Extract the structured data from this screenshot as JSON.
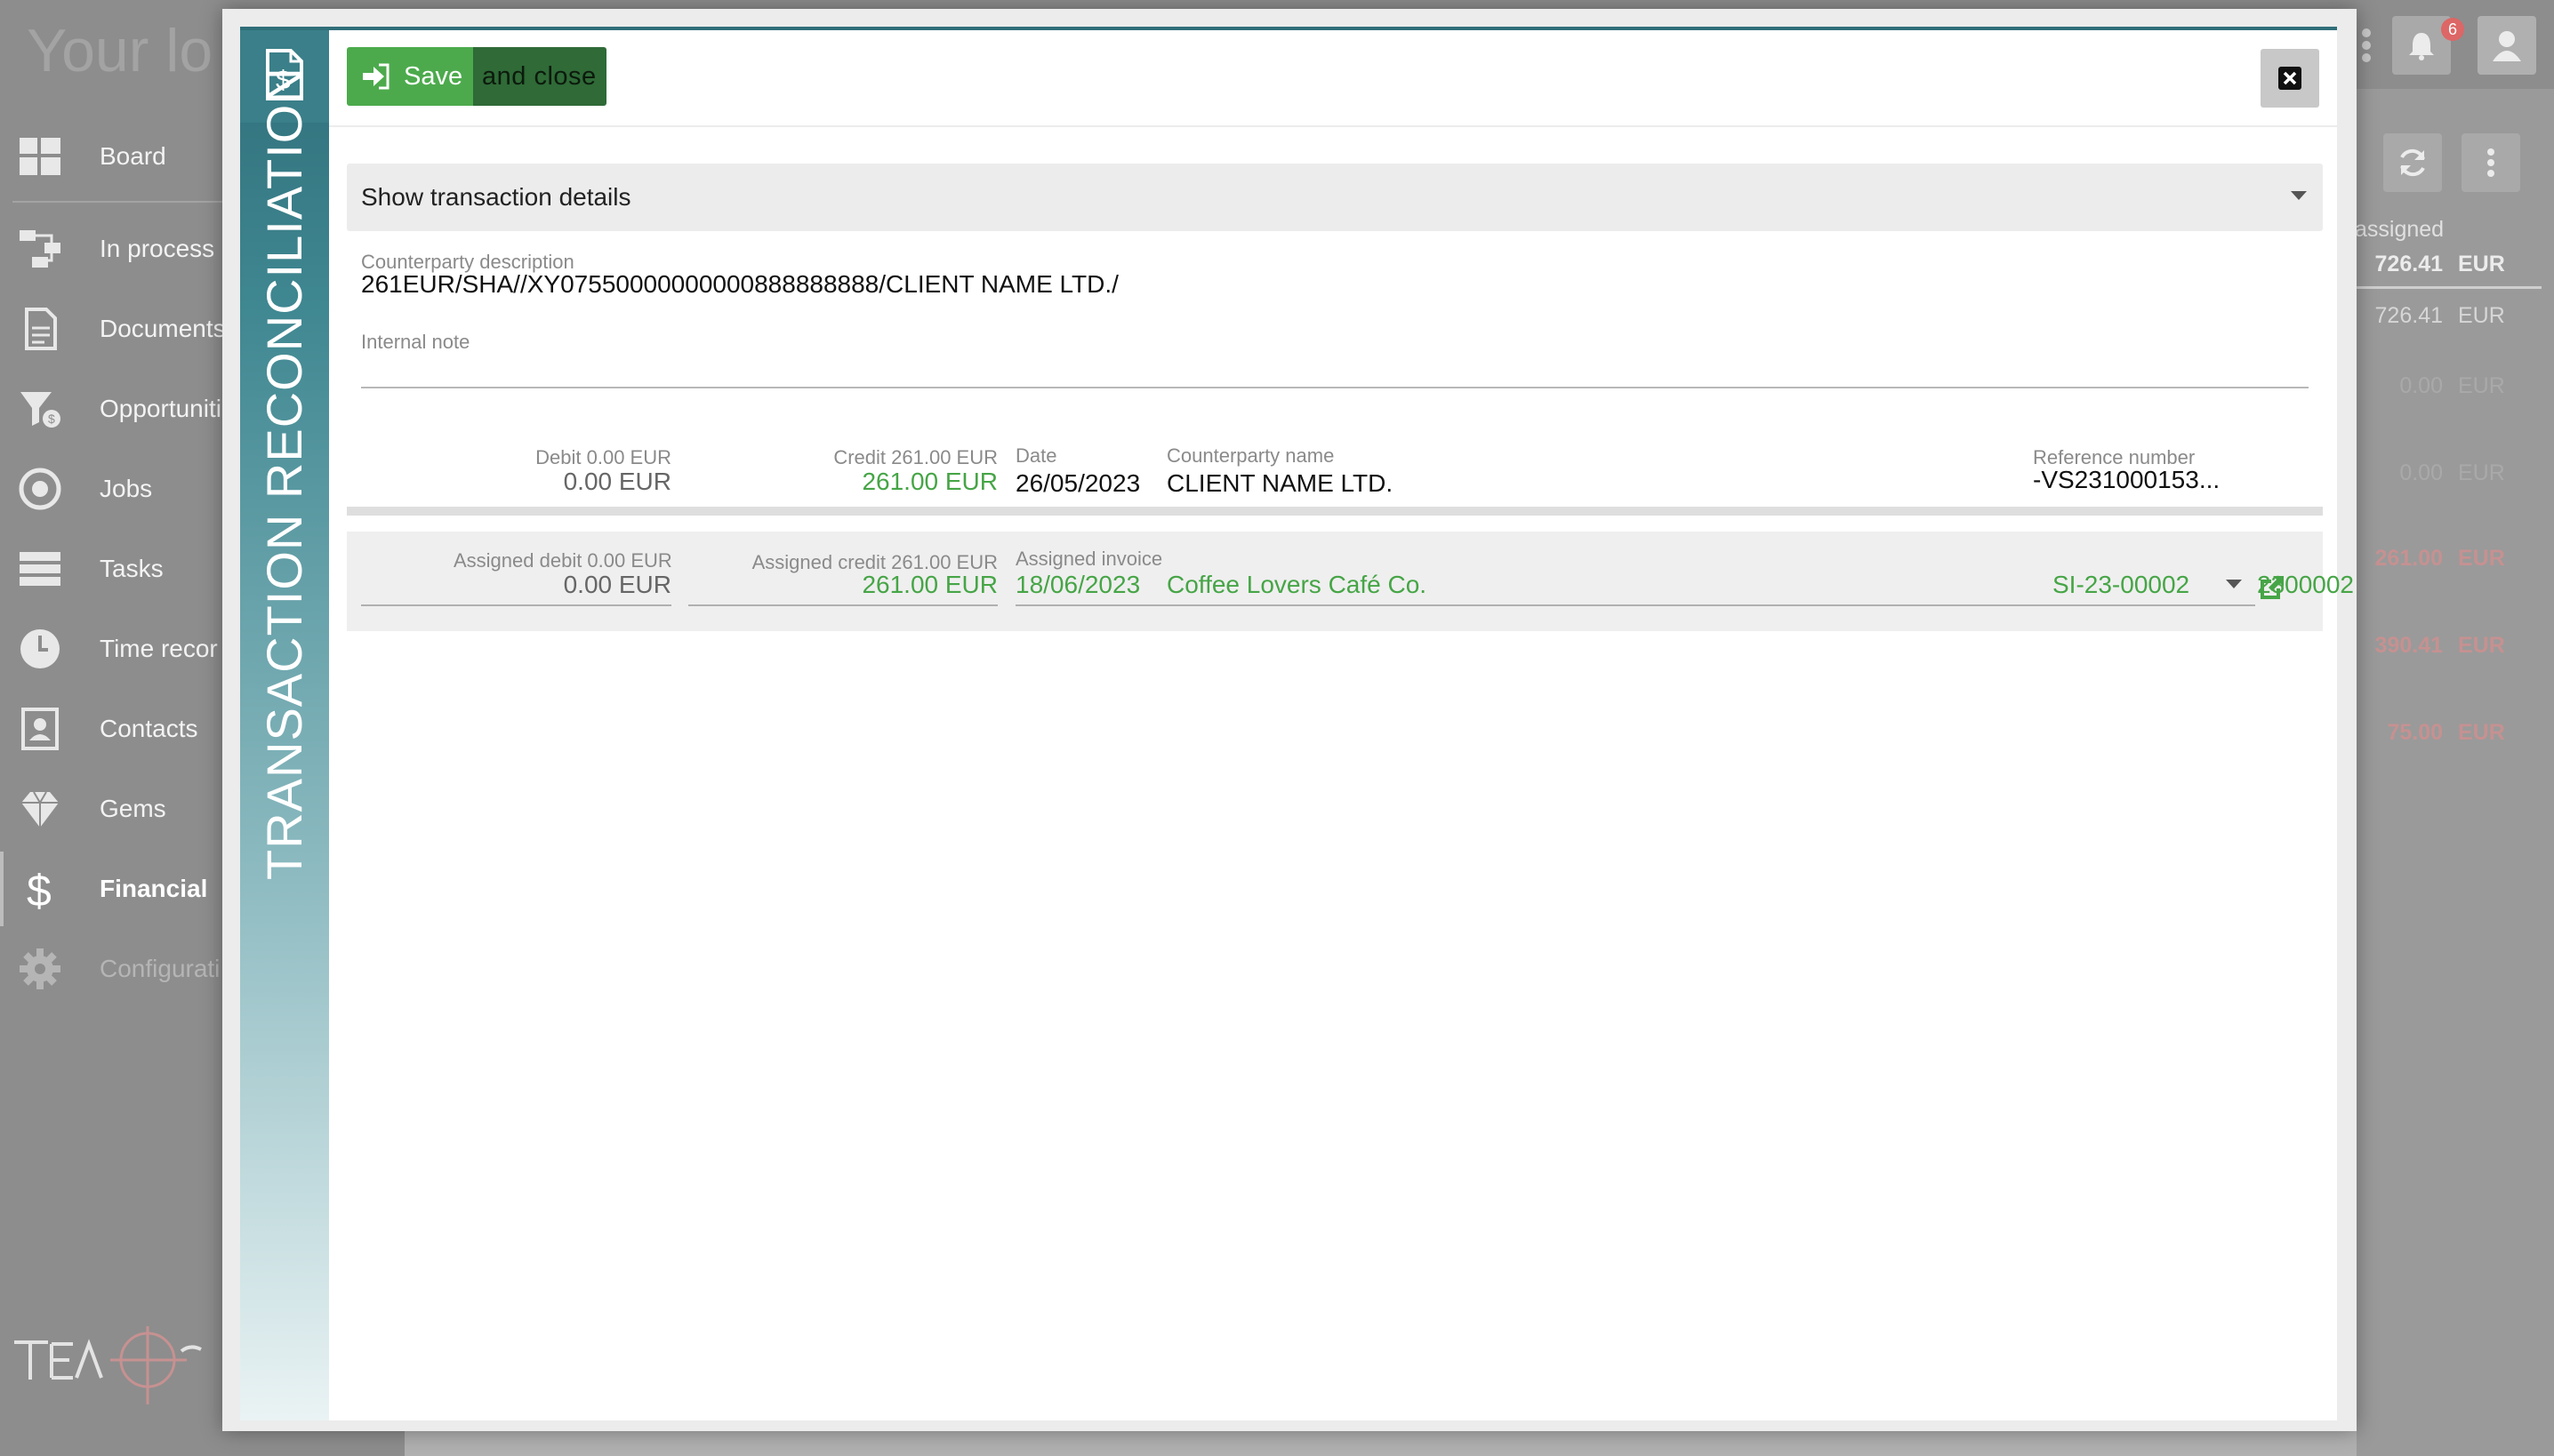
{
  "background": {
    "logo_text": "Your lo",
    "nav": [
      {
        "label": "Board",
        "icon": "board-icon"
      },
      {
        "label": "In process",
        "icon": "process-icon"
      },
      {
        "label": "Documents",
        "icon": "document-icon"
      },
      {
        "label": "Opportuniti",
        "icon": "opportunity-icon"
      },
      {
        "label": "Jobs",
        "icon": "jobs-icon"
      },
      {
        "label": "Tasks",
        "icon": "tasks-icon"
      },
      {
        "label": "Time recor",
        "icon": "clock-icon"
      },
      {
        "label": "Contacts",
        "icon": "contacts-icon"
      },
      {
        "label": "Gems",
        "icon": "gem-icon"
      },
      {
        "label": "Financial",
        "icon": "dollar-icon"
      },
      {
        "label": "Configurati",
        "icon": "gear-icon"
      }
    ],
    "notifications_count": "6",
    "assigned_header": "assigned",
    "amounts": [
      {
        "value": "726.41",
        "currency": "EUR"
      },
      {
        "value": "726.41",
        "currency": "EUR"
      },
      {
        "value": "0.00",
        "currency": "EUR"
      },
      {
        "value": "0.00",
        "currency": "EUR"
      },
      {
        "value": "261.00",
        "currency": "EUR"
      },
      {
        "value": "390.41",
        "currency": "EUR"
      },
      {
        "value": "75.00",
        "currency": "EUR"
      }
    ]
  },
  "modal": {
    "side_title": "TRANSACTION RECONCILIATION",
    "save_label": "Save",
    "close_label": "and close",
    "details_toggle": "Show transaction details",
    "counterparty_description_label": "Counterparty description",
    "counterparty_description": "261EUR/SHA//XY07550000000000888888888/CLIENT NAME LTD./",
    "internal_note_label": "Internal note",
    "transaction": {
      "debit_label": "Debit 0.00 EUR",
      "debit_value": "0.00 EUR",
      "credit_label": "Credit 261.00 EUR",
      "credit_value": "261.00 EUR",
      "date_label": "Date",
      "date_value": "26/05/2023",
      "counterparty_name_label": "Counterparty name",
      "counterparty_name": "CLIENT NAME LTD.",
      "reference_label": "Reference number",
      "reference_value": "-VS231000153..."
    },
    "assignment": {
      "assigned_debit_label": "Assigned debit 0.00 EUR",
      "assigned_debit_value": "0.00 EUR",
      "assigned_credit_label": "Assigned credit 261.00 EUR",
      "assigned_credit_value": "261.00 EUR",
      "assigned_invoice_label": "Assigned invoice",
      "invoice_date": "18/06/2023",
      "invoice_client": "Coffee Lovers Café Co.",
      "invoice_number": "SI-23-00002",
      "invoice_ref": "2300002"
    }
  },
  "colors": {
    "accent": "#2f6e79",
    "save_green": "#4caa4c",
    "assigned_green": "#46a546"
  }
}
